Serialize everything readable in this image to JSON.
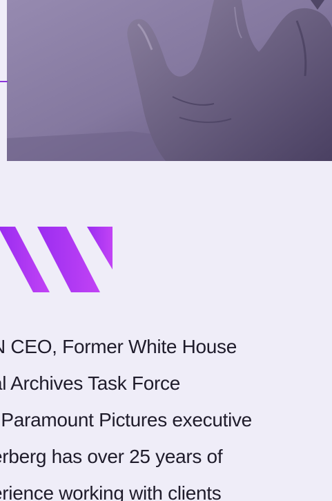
{
  "bio": {
    "lines": [
      "N CEO, Former White House",
      "al Archives Task Force",
      "l Paramount Pictures executive",
      "erberg has over 25 years of",
      "erience working with clients"
    ]
  },
  "colors": {
    "background": "#efedf8",
    "photo_tint": "#7a6e95",
    "accent": "#a12ef0",
    "text": "#1f1c2b"
  }
}
